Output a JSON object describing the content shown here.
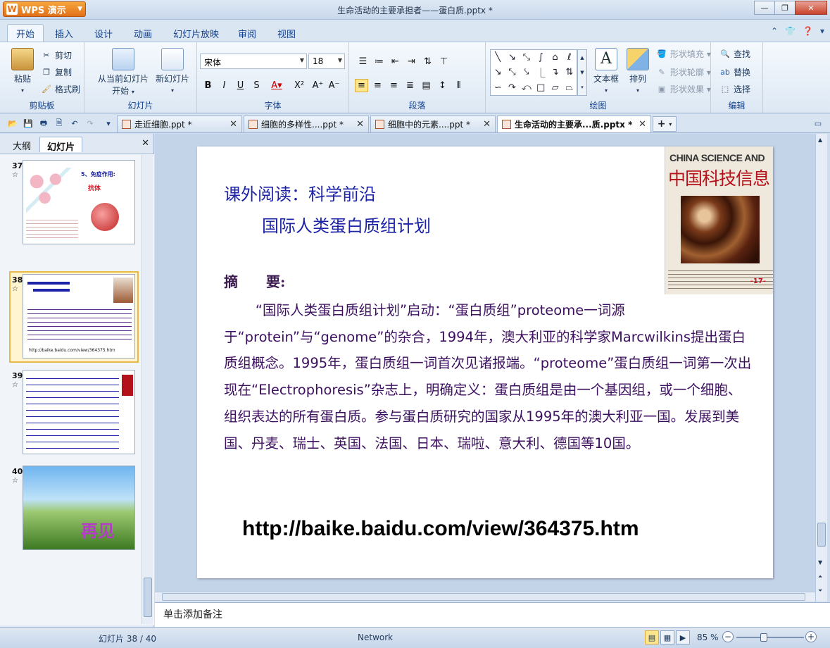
{
  "app": {
    "badge": "WPS 演示",
    "window_title": "生命活动的主要承担者——蛋白质.pptx *"
  },
  "ribbon_tabs": [
    "开始",
    "插入",
    "设计",
    "动画",
    "幻灯片放映",
    "审阅",
    "视图"
  ],
  "clipboard": {
    "paste": "粘贴",
    "cut": "剪切",
    "copy": "复制",
    "format_painter": "格式刷",
    "label": "剪贴板"
  },
  "slides_group": {
    "from_current": "从当前幻灯片",
    "start": "开始",
    "new_slide": "新幻灯片",
    "label": "幻灯片"
  },
  "font_group": {
    "font_name": "宋体",
    "font_size": "18",
    "label": "字体"
  },
  "paragraph_group": {
    "label": "段落"
  },
  "drawing_group": {
    "text_box": "文本框",
    "arrange": "排列",
    "shape_fill": "形状填充",
    "shape_outline": "形状轮廓",
    "shape_effect": "形状效果",
    "label": "绘图"
  },
  "editing_group": {
    "find": "查找",
    "replace": "替换",
    "select": "选择",
    "label": "编辑"
  },
  "doc_tabs": [
    {
      "label": "走近细胞.ppt *"
    },
    {
      "label": "细胞的多样性....ppt *"
    },
    {
      "label": "细胞中的元素....ppt *"
    },
    {
      "label": "生命活动的主要承...质.pptx *"
    }
  ],
  "panel": {
    "outline_tab": "大纲",
    "slides_tab": "幻灯片"
  },
  "thumbnails": [
    {
      "num": "37",
      "heading": "5、免疫作用:",
      "sub": "抗体"
    },
    {
      "num": "38",
      "url": "http://baike.baidu.com/view/364375.htm"
    },
    {
      "num": "39"
    },
    {
      "num": "40",
      "text": "再见"
    }
  ],
  "slide": {
    "title1": "课外阅读：科学前沿",
    "title2": "国际人类蛋白质组计划",
    "abstract_label": "摘　　要:",
    "body": "“国际人类蛋白质组计划”启动：“蛋白质组”proteome一词源于“protein”与“genome”的杂合，1994年，澳大利亚的科学家Marcwilkins提出蛋白质组概念。1995年，蛋白质组一词首次见诸报端。“proteome”蛋白质组一词第一次出现在“Electrophoresis”杂志上，明确定义：蛋白质组是由一个基因组，或一个细胞、组织表达的所有蛋白质。参与蛋白质研究的国家从1995年的澳大利亚一国。发展到美国、丹麦、瑞士、英国、法国、日本、瑞啦、意大利、德国等10国。",
    "url": "http://baike.baidu.com/view/364375.htm",
    "cover_en": "CHINA SCIENCE AND",
    "cover_cn": "中国科技信息",
    "cover_num": "-17-"
  },
  "notes_placeholder": "单击添加备注",
  "status": {
    "slide_indicator": "幻灯片 38 / 40",
    "network": "Network",
    "zoom": "85 %",
    "zoom_value_percent": 85
  },
  "colors": {
    "title_blue": "#1c23a6",
    "body_purple": "#3d1060",
    "accent_orange": "#e2701a"
  }
}
